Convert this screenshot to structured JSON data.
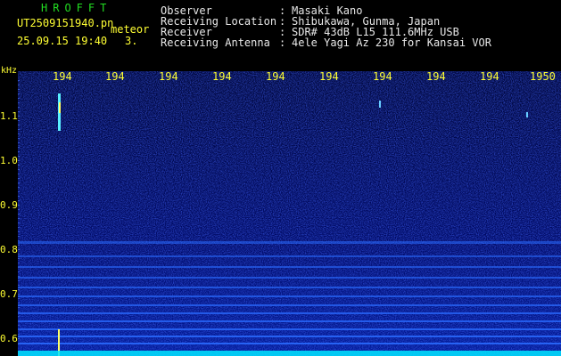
{
  "header": {
    "app_name": "HROFFT",
    "filename": "UT2509151940.pn",
    "tag": "meteor",
    "datetime": "25.09.15 19:40",
    "number": "3.",
    "observer_label": "Observer",
    "observer": "Masaki Kano",
    "location_label": "Receiving Location",
    "location": "Shibukawa, Gunma, Japan",
    "receiver_label": "Receiver",
    "receiver": "SDR# 43dB L15 111.6MHz USB",
    "antenna_label": "Receiving Antenna",
    "antenna": "4ele Yagi Az 230 for Kansai VOR",
    "separator": ":"
  },
  "axes": {
    "y_unit": "kHz",
    "y_ticks": [
      "1.1",
      "1.0",
      "0.9",
      "0.8",
      "0.7",
      "0.6"
    ],
    "x_ticks": [
      "194",
      "194",
      "194",
      "194",
      "194",
      "194",
      "194",
      "194",
      "194",
      "1950"
    ]
  },
  "colors": {
    "background": "#000000",
    "spectrogram_base": "#000a66",
    "band": "#2a6bff",
    "axis_text": "#ffff33",
    "app_text": "#22dd22"
  }
}
